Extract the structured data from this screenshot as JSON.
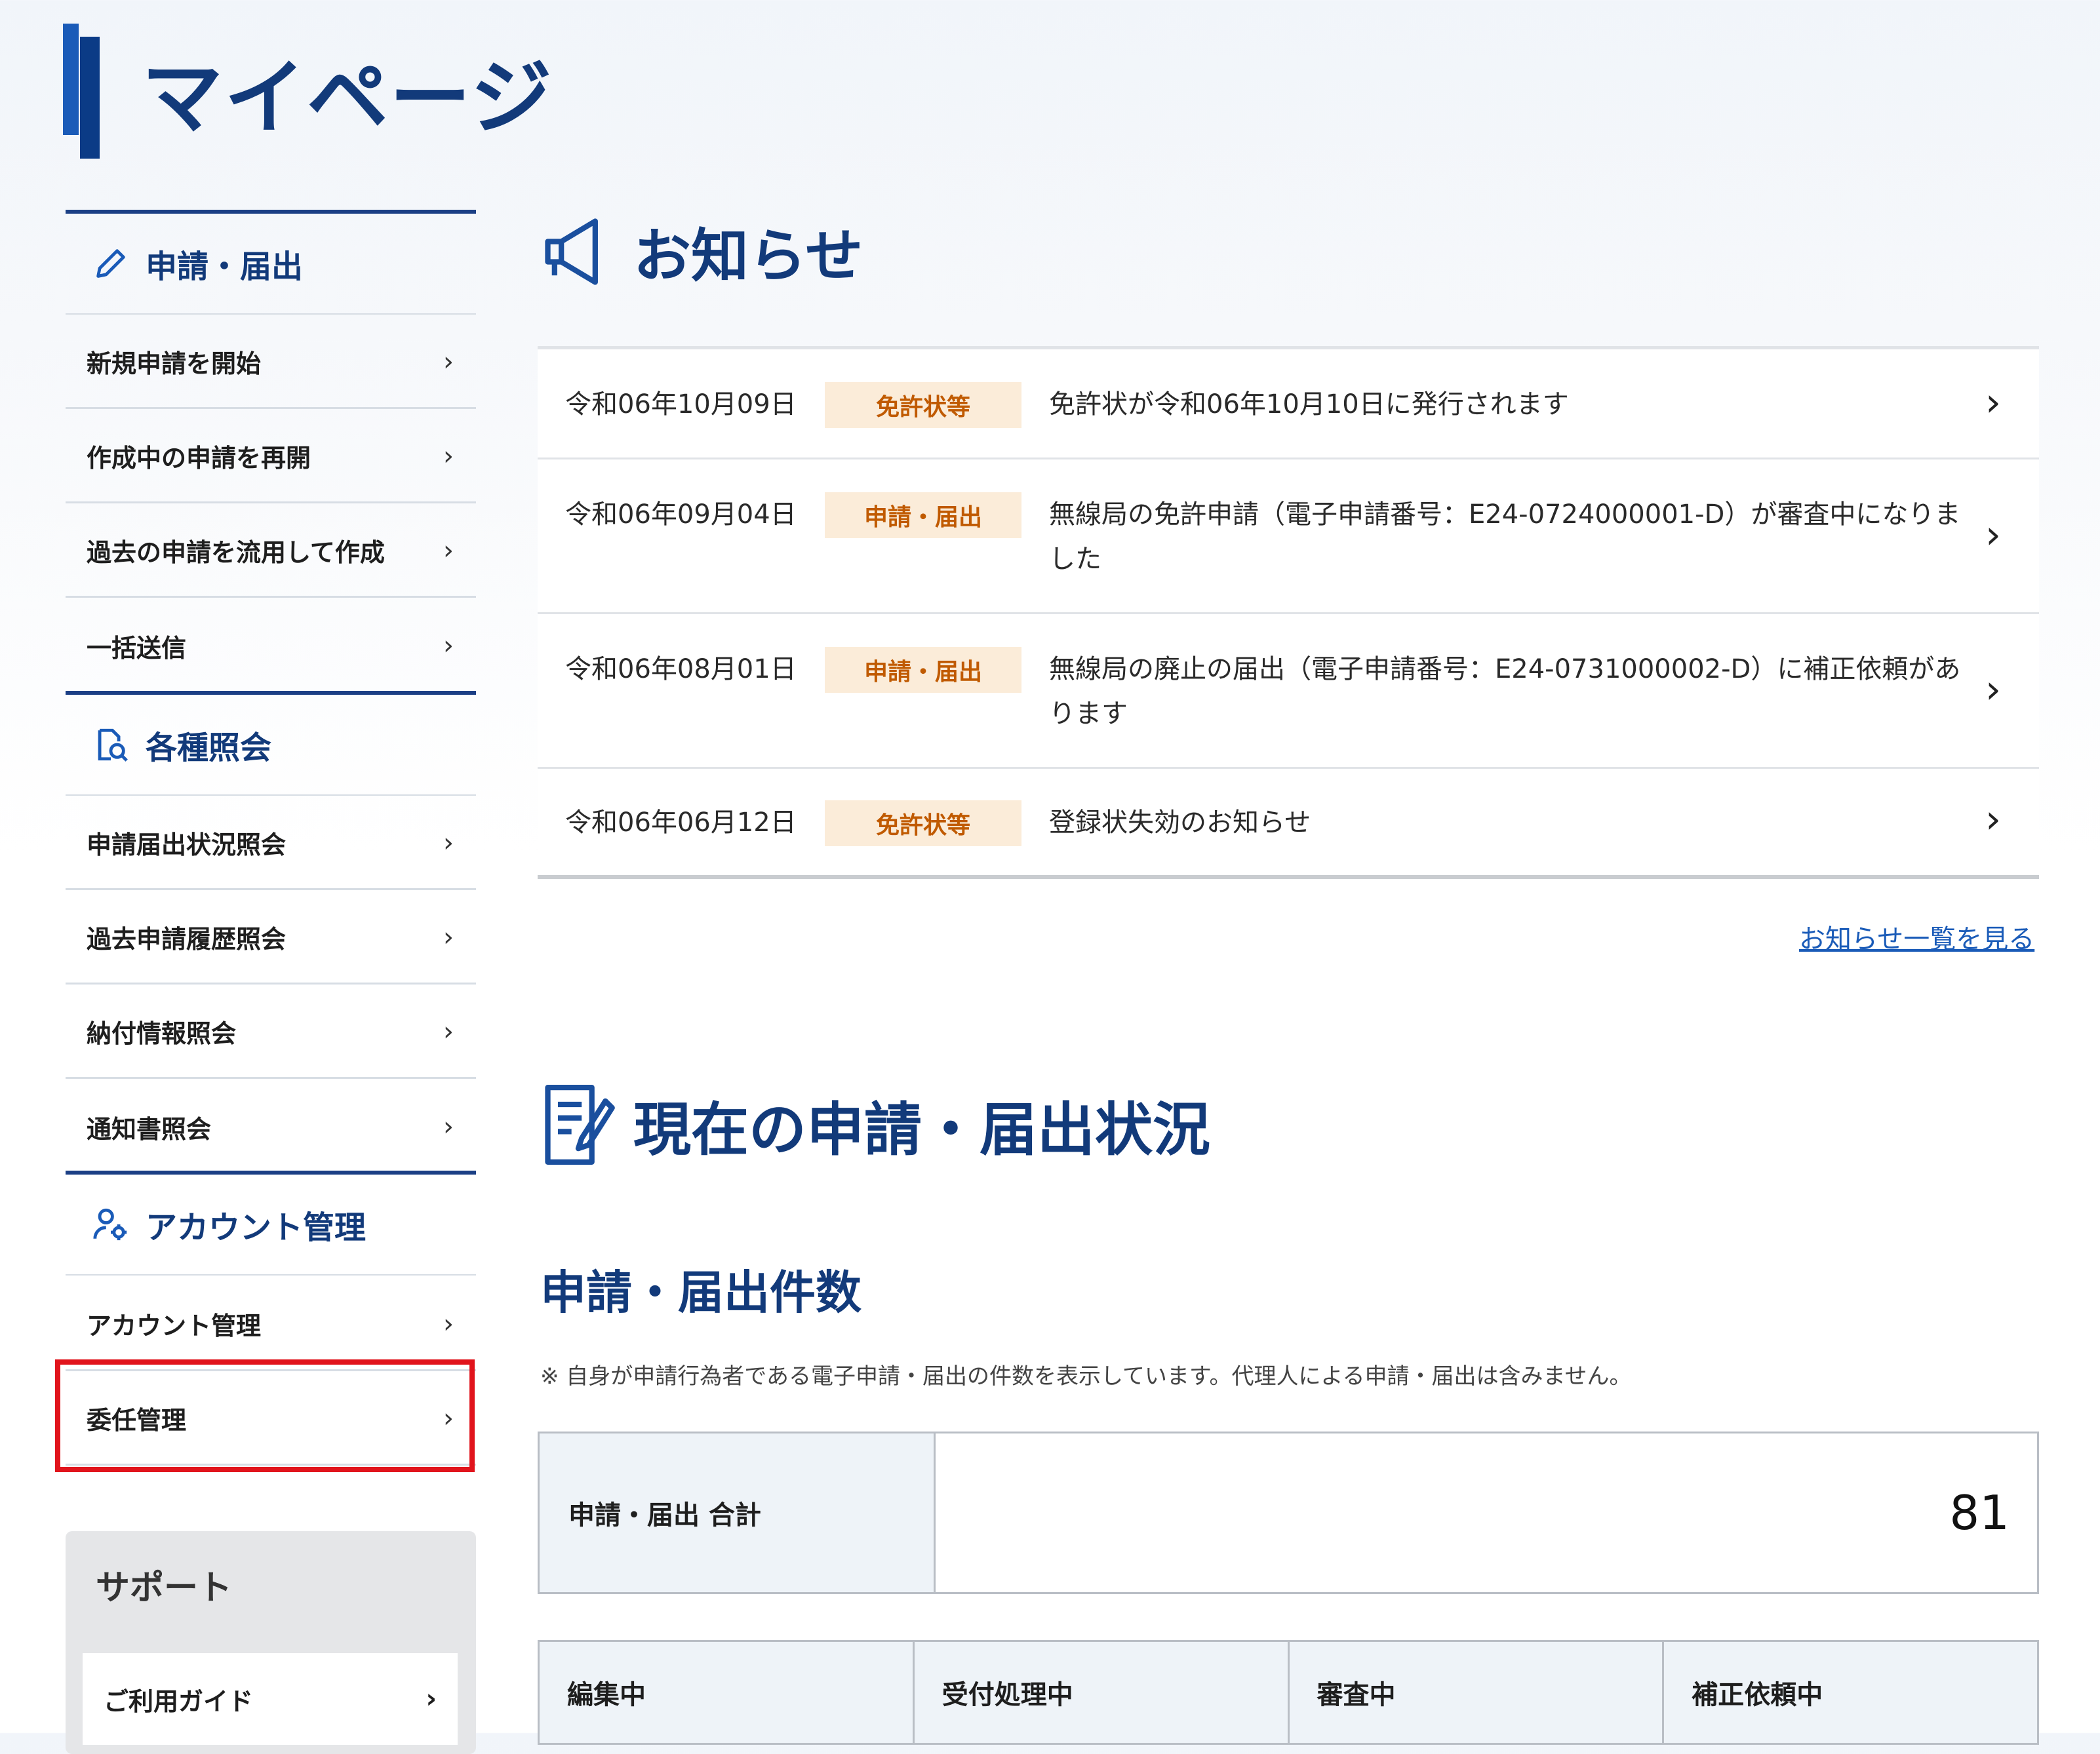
{
  "page_title": "マイページ",
  "sidebar": {
    "sections": [
      {
        "heading": "申請・届出",
        "icon": "pencil-icon",
        "items": [
          "新規申請を開始",
          "作成中の申請を再開",
          "過去の申請を流用して作成",
          "一括送信"
        ]
      },
      {
        "heading": "各種照会",
        "icon": "document-search-icon",
        "items": [
          "申請届出状況照会",
          "過去申請履歴照会",
          "納付情報照会",
          "通知書照会"
        ]
      },
      {
        "heading": "アカウント管理",
        "icon": "user-gear-icon",
        "items": [
          "アカウント管理",
          "委任管理"
        ]
      }
    ],
    "support": {
      "title": "サポート",
      "guide": "ご利用ガイド"
    },
    "highlighted_item": "委任管理",
    "highlight_color": "#e1141c"
  },
  "notices": {
    "heading": "お知らせ",
    "items": [
      {
        "date": "令和06年10月09日",
        "tag": "免許状等",
        "text": "免許状が令和06年10月10日に発行されます"
      },
      {
        "date": "令和06年09月04日",
        "tag": "申請・届出",
        "text": "無線局の免許申請（電子申請番号：E24-0724000001-D）が審査中になりました"
      },
      {
        "date": "令和06年08月01日",
        "tag": "申請・届出",
        "text": "無線局の廃止の届出（電子申請番号：E24-0731000002-D）に補正依頼があります"
      },
      {
        "date": "令和06年06月12日",
        "tag": "免許状等",
        "text": "登録状失効のお知らせ"
      }
    ],
    "more_link": "お知らせ一覧を見る"
  },
  "status": {
    "heading": "現在の申請・届出状況",
    "count_heading": "申請・届出件数",
    "note": "※ 自身が申請行為者である電子申請・届出の件数を表示しています。代理人による申請・届出は含みません。",
    "total_label": "申請・届出 合計",
    "total_value": "81",
    "breakdown": [
      "編集中",
      "受付処理中",
      "審査中",
      "補正依頼中"
    ]
  },
  "colors": {
    "brand_navy": "#123a7a",
    "brand_blue": "#1a5bb8",
    "tag_bg": "#fbecd9",
    "tag_text": "#c05a00"
  }
}
